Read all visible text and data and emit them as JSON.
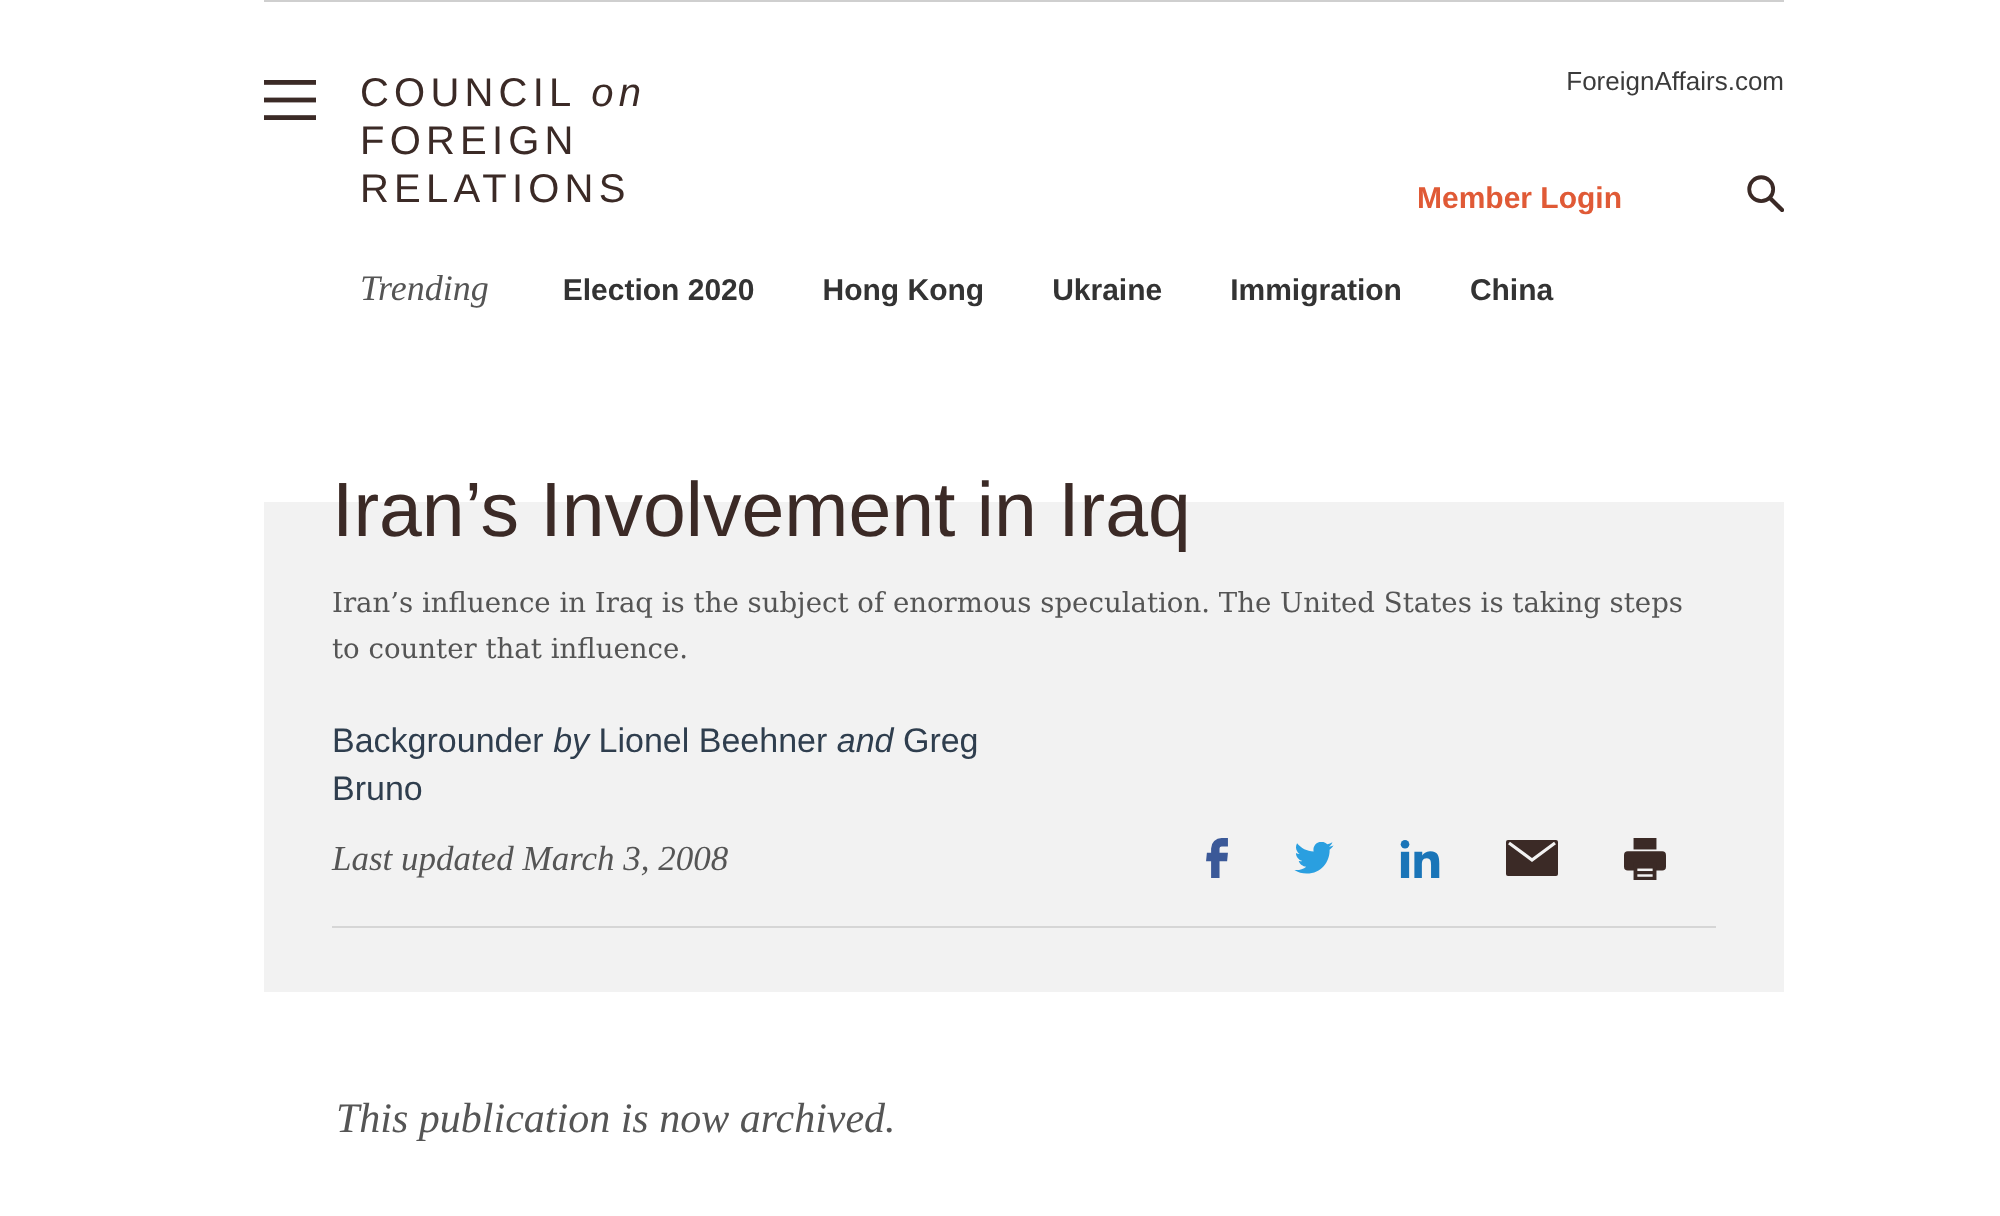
{
  "header": {
    "logo": {
      "lines": [
        "COUNCIL *on*",
        "FOREIGN",
        "RELATIONS"
      ]
    },
    "external_link": "ForeignAffairs.com",
    "login_link": "Member Login"
  },
  "trending": {
    "label": "Trending",
    "topics": [
      "Election 2020",
      "Hong Kong",
      "Ukraine",
      "Immigration",
      "China"
    ]
  },
  "article": {
    "title": "Iran’s Involvement in Iraq",
    "summary": "Iran’s influence in Iraq is the subject of enormous speculation. The United States is taking steps to counter that influence.",
    "byline": "Backgrounder *by* Lionel Beehner *and* Greg Bruno",
    "updated": "Last updated March 3, 2008",
    "share": [
      {
        "kind": "facebook"
      },
      {
        "kind": "twitter"
      },
      {
        "kind": "linkedin"
      },
      {
        "kind": "email"
      },
      {
        "kind": "print"
      }
    ]
  },
  "notice": "This publication is now archived."
}
